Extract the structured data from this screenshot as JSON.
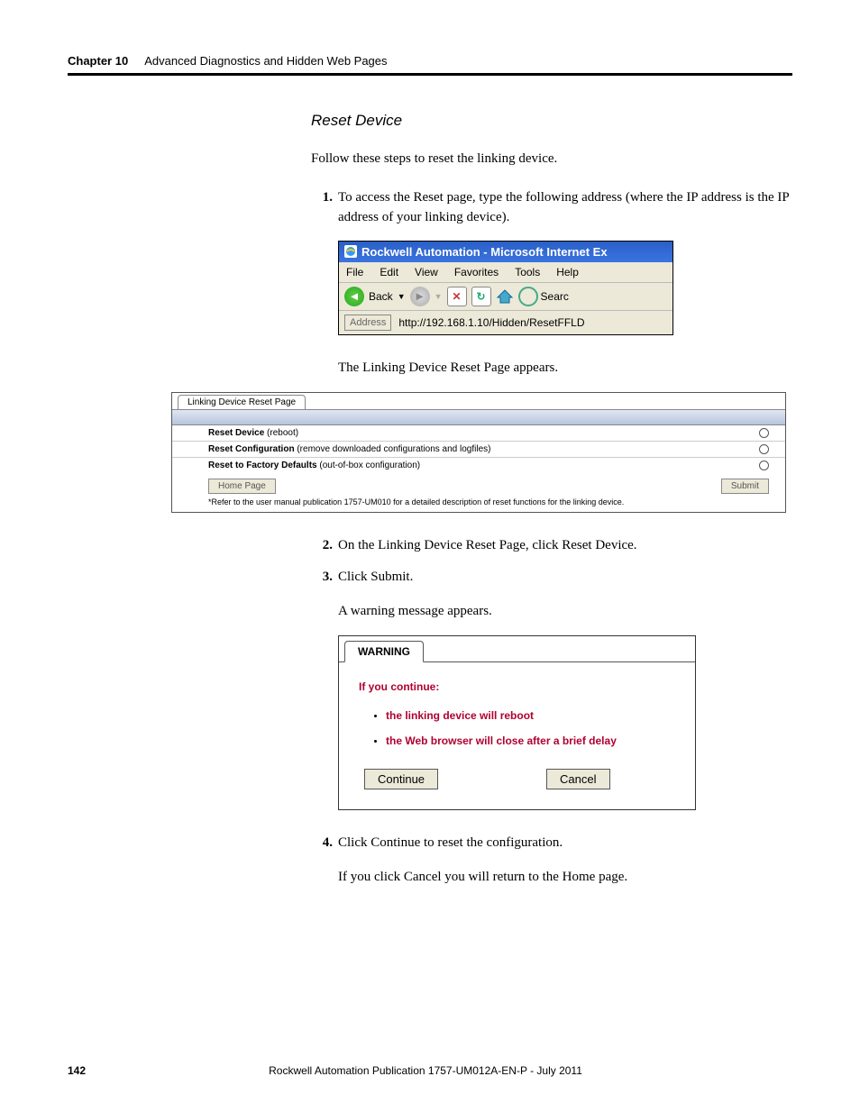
{
  "header": {
    "chapter": "Chapter 10",
    "title": "Advanced Diagnostics and Hidden Web Pages"
  },
  "section_heading": "Reset Device",
  "intro": "Follow these steps to reset the linking device.",
  "step1_num": "1.",
  "step1_text": "To access the Reset page, type the following address (where the IP address is the IP address of your linking device).",
  "ie": {
    "title": "Rockwell Automation - Microsoft Internet Ex",
    "menu": [
      "File",
      "Edit",
      "View",
      "Favorites",
      "Tools",
      "Help"
    ],
    "back": "Back",
    "search": "Searc",
    "addr_label": "Address",
    "url": "http://192.168.1.10/Hidden/ResetFFLD"
  },
  "after_ie": "The Linking Device Reset Page appears.",
  "reset_page": {
    "tab": "Linking Device Reset Page",
    "row1_strong": "Reset Device",
    "row1_rest": " (reboot)",
    "row2_strong": "Reset Configuration",
    "row2_rest": " (remove downloaded configurations and logfiles)",
    "row3_strong": "Reset to Factory Defaults",
    "row3_rest": " (out-of-box configuration)",
    "home_btn": "Home Page",
    "submit_btn": "Submit",
    "footnote": "*Refer to the user manual publication 1757-UM010 for a detailed description of reset functions for the linking device."
  },
  "step2_num": "2.",
  "step2_text": "On the Linking Device Reset Page, click Reset Device.",
  "step3_num": "3.",
  "step3_text": "Click Submit.",
  "after_step3": "A warning message appears.",
  "warning": {
    "tab": "WARNING",
    "heading": "If you continue:",
    "bullet1": "the linking device will reboot",
    "bullet2": "the Web browser will close after a brief delay",
    "continue": "Continue",
    "cancel": "Cancel"
  },
  "step4_num": "4.",
  "step4_text": "Click Continue to reset the configuration.",
  "after_step4": "If you click Cancel you will return to the Home page.",
  "footer": {
    "page": "142",
    "pub": "Rockwell Automation Publication 1757-UM012A-EN-P - July 2011"
  }
}
